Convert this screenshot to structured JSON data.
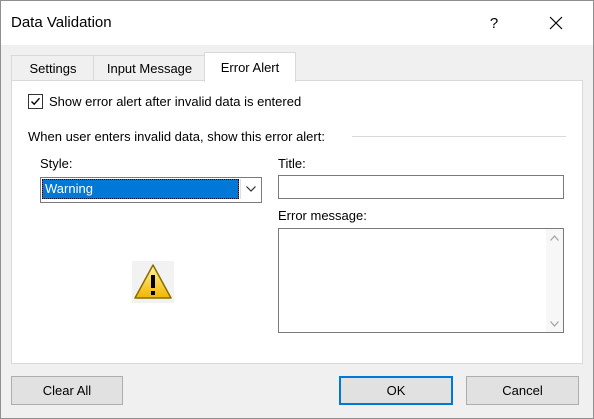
{
  "window": {
    "title": "Data Validation",
    "help": "?"
  },
  "tabs": [
    {
      "label": "Settings"
    },
    {
      "label": "Input Message"
    },
    {
      "label": "Error Alert"
    }
  ],
  "active_tab": "Error Alert",
  "error_alert": {
    "show_checkbox": {
      "label": "Show error alert after invalid data is entered",
      "checked": true
    },
    "section_label": "When user enters invalid data, show this error alert:",
    "style_label": "Style:",
    "style_value": "Warning",
    "title_label": "Title:",
    "title_value": "",
    "error_message_label": "Error message:",
    "error_message_value": ""
  },
  "buttons": {
    "clear_all": "Clear All",
    "ok": "OK",
    "cancel": "Cancel"
  },
  "colors": {
    "accent": "#0078d7",
    "dialog_bg": "#f0f0f0",
    "warning": "#ffd21f"
  }
}
